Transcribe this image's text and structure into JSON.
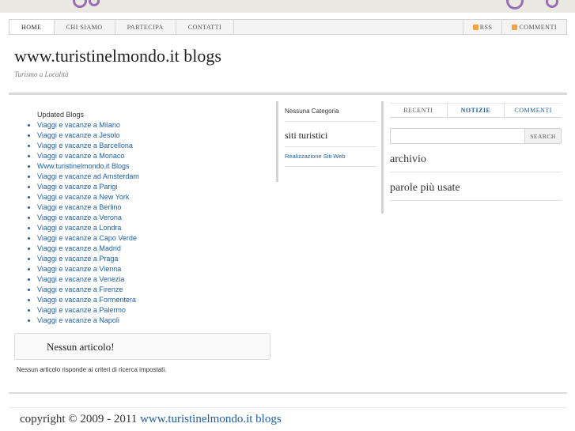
{
  "nav": {
    "items": [
      "HOME",
      "CHI SIAMO",
      "PARTECIPA",
      "CONTATTI"
    ],
    "rss_label": "RSS",
    "comments_label": "COMMENTI"
  },
  "header": {
    "title": "www.turistinelmondo.it blogs",
    "tagline": "Turismo a Località"
  },
  "main": {
    "updated_title": "Updated Blogs",
    "blogs": [
      "Viaggi e vacanze a Milano",
      "Viaggi e vacanze a Jesolo",
      "Viaggi e vacanze a Barcellona",
      "Viaggi e vacanze a Monaco",
      "Www.turistinelmondo.it Blogs",
      "Viaggi e vacanze ad Amsterdam",
      "Viaggi e vacanze a Parigi",
      "Viaggi e vacanze a New York",
      "Viaggi e vacanze a Berlino",
      "Viaggi e vacanze a Verona",
      "Viaggi e vacanze a Londra",
      "Viaggi e vacanze a Capo Verde",
      "Viaggi e vacanze a Madrid",
      "Viaggi e vacanze a Praga",
      "Viaggi e vacanze a Vienna",
      "Viaggi e vacanze a Venezia",
      "Viaggi e vacanze a Firenze",
      "Viaggi e vacanze a Formentera",
      "Viaggi e vacanze a Palermo",
      "Viaggi e vacanze a Napoli"
    ],
    "no_article_title": "Nessun articolo!",
    "no_article_text": "Nessun articolo risponde ai criteri di ricerca impostati."
  },
  "middle": {
    "category": "Nessuna Categoria",
    "heading": "siti turistici",
    "link": "Realizzazione Siti Web"
  },
  "sidebar": {
    "tabs": [
      "RECENTI",
      "NOTIZIE",
      "COMMENTI"
    ],
    "search_button": "SEARCH",
    "archive_heading": "archivio",
    "tags_heading": "parole più usate"
  },
  "footer": {
    "copyright": "copyright © 2009 - 2011",
    "link": "www.turistinelmondo.it blogs"
  },
  "colors": {
    "link": "#1d5fa3",
    "rss": "#f5a240",
    "decor": "#9c6bb5"
  }
}
